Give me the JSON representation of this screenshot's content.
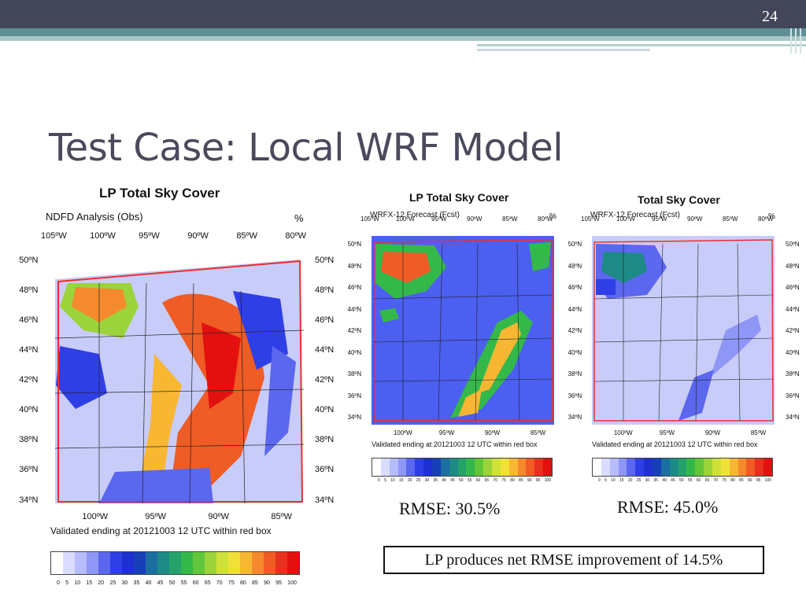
{
  "slide_number": "24",
  "title": "Test Case:  Local WRF Model",
  "colors": {
    "topbar": "#434659",
    "teal": "#5f8f93",
    "map_bg": "#4b5ff0",
    "red_box": "#e83030"
  },
  "colorbar": {
    "ticks": [
      "0",
      "5",
      "10",
      "15",
      "20",
      "25",
      "30",
      "35",
      "40",
      "45",
      "50",
      "55",
      "60",
      "65",
      "70",
      "75",
      "80",
      "85",
      "90",
      "95",
      "100"
    ],
    "colors": [
      "#ffffff",
      "#d9dcff",
      "#b7bcfb",
      "#8f97f6",
      "#5b67ee",
      "#2f3fe6",
      "#1f30d0",
      "#173fb8",
      "#1a6fa0",
      "#1d8a86",
      "#23a36a",
      "#35b84a",
      "#62c63a",
      "#9bd43a",
      "#cfe03a",
      "#f0e038",
      "#f7b733",
      "#f48a2d",
      "#ef5c25",
      "#e8301f",
      "#e31010"
    ]
  },
  "left_panel": {
    "title": "LP Total Sky Cover",
    "subtitle": "NDFD Analysis (Obs)",
    "unit": "%",
    "top_lon": [
      "105ºW",
      "100ºW",
      "95ºW",
      "90ºW",
      "85ºW",
      "80ºW"
    ],
    "bottom_lon": [
      "100ºW",
      "95ºW",
      "90ºW",
      "85ºW"
    ],
    "lat": [
      "50ºN",
      "48ºN",
      "46ºN",
      "44ºN",
      "42ºN",
      "40ºN",
      "38ºN",
      "36ºN",
      "34ºN"
    ],
    "validated": "Validated ending at 20121003 12 UTC within red box"
  },
  "mid_panel": {
    "title": "LP Total Sky Cover",
    "subtitle": "WRFX-12 Forecast (Fcst)",
    "unit": "%",
    "top_lon": [
      "105ºW",
      "100ºW",
      "95ºW",
      "90ºW",
      "85ºW",
      "80ºW"
    ],
    "bottom_lon": [
      "100ºW",
      "95ºW",
      "90ºW",
      "85ºW"
    ],
    "lat": [
      "50ºN",
      "48ºN",
      "46ºN",
      "44ºN",
      "42ºN",
      "40ºN",
      "38ºN",
      "36ºN",
      "34ºN"
    ],
    "validated": "Validated ending at 20121003 12 UTC within red box",
    "rmse": "RMSE:  30.5%"
  },
  "right_panel": {
    "title": "Total Sky Cover",
    "subtitle": "WRFX-12 Forecast (Fcst)",
    "unit": "%",
    "top_lon": [
      "105ºW",
      "100ºW",
      "95ºW",
      "90ºW",
      "85ºW",
      "80ºW"
    ],
    "bottom_lon": [
      "100ºW",
      "95ºW",
      "90ºW",
      "85ºW"
    ],
    "lat": [
      "50ºN",
      "48ºN",
      "46ºN",
      "44ºN",
      "42ºN",
      "40ºN",
      "38ºN",
      "36ºN",
      "34ºN"
    ],
    "validated": "Validated ending at 20121003 12 UTC within red box",
    "rmse": "RMSE:  45.0%"
  },
  "conclusion": "LP produces net RMSE improvement of 14.5%"
}
